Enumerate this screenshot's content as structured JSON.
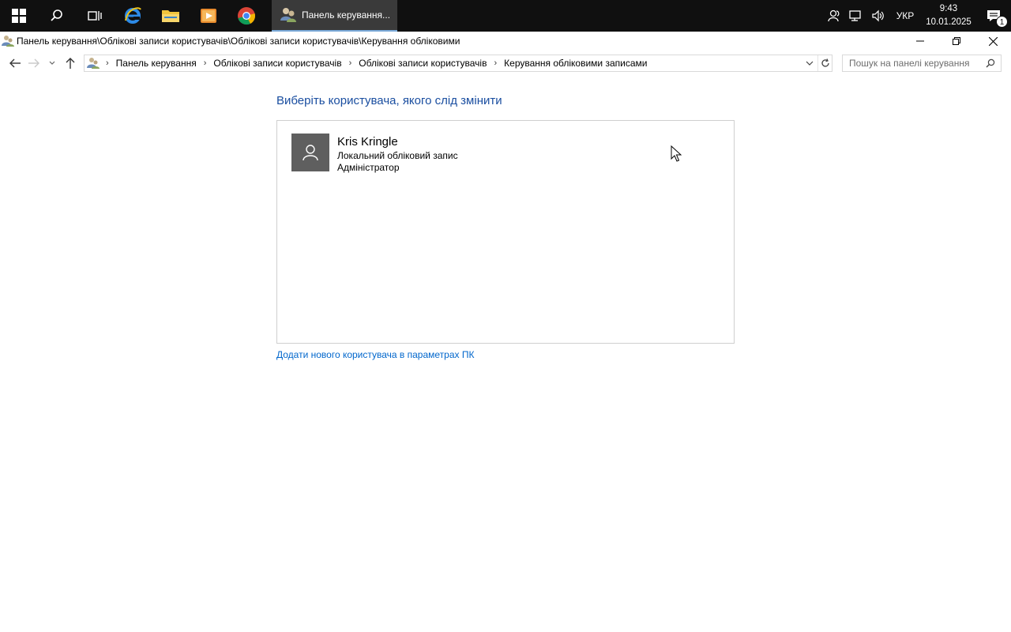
{
  "taskbar": {
    "active_app_label": "Панель керування...",
    "lang": "УКР",
    "time": "9:43",
    "date": "10.01.2025",
    "notif_count": "1"
  },
  "window": {
    "title": "Панель керування\\Облікові записи користувачів\\Облікові записи користувачів\\Керування обліковими"
  },
  "address": {
    "crumbs": [
      "Панель керування",
      "Облікові записи користувачів",
      "Облікові записи користувачів",
      "Керування обліковими записами"
    ]
  },
  "search": {
    "placeholder": "Пошук на панелі керування"
  },
  "main": {
    "heading": "Виберіть користувача, якого слід змінити",
    "account": {
      "name": "Kris Kringle",
      "type": "Локальний обліковий запис",
      "role": "Адміністратор"
    },
    "add_user_link": "Додати нового користувача в параметрах ПК"
  },
  "colors": {
    "taskbar_bg": "#101010",
    "heading_blue": "#1a4ea0",
    "link_blue": "#0066cc"
  }
}
